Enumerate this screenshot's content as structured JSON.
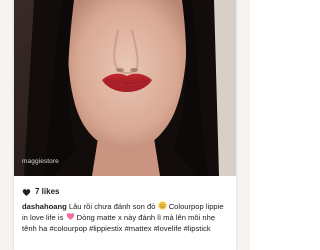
{
  "post": {
    "watermark": "maggiestore",
    "likes": "7 likes",
    "username": "dashahoang",
    "caption_line1_a": "Lâu rồi chưa đánh son đỏ",
    "caption_line1_b": "Colourpop lippie",
    "caption_line2_a": "in love life is",
    "caption_line2_b": "Dòng matte x này đánh lì mà lên môi nhẹ",
    "caption_line3": "tênh ha #colourpop #lippiestix #mattex #lovelife #lipstick",
    "icons": {
      "likes": "heart-outline-icon",
      "emoji1": "smiling-face-emoji-icon",
      "emoji2": "pink-heart-emoji-icon"
    },
    "colors": {
      "lip": "#b8242c",
      "text": "#1e1e1e"
    }
  }
}
